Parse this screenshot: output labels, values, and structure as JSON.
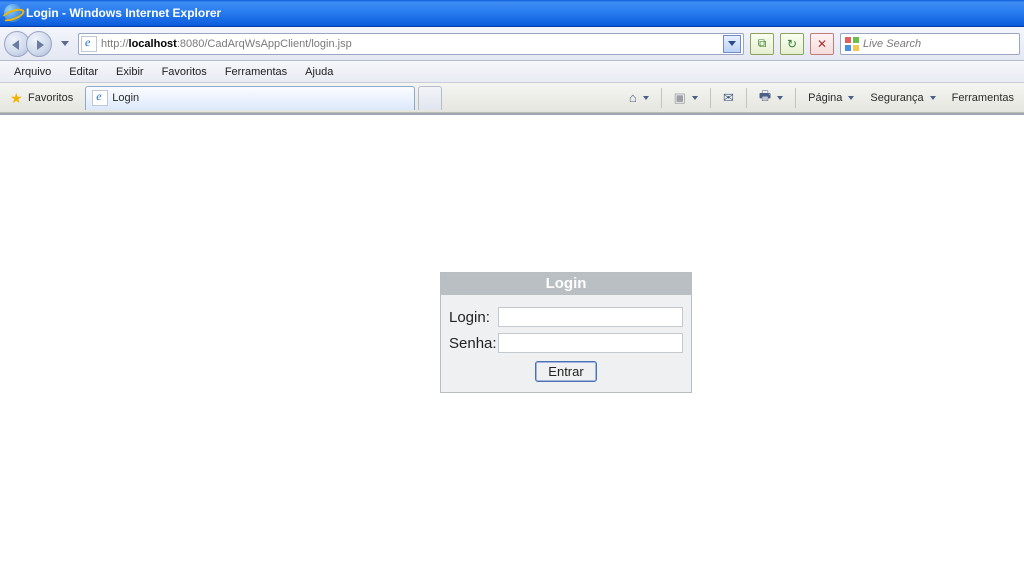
{
  "window": {
    "title": "Login - Windows Internet Explorer"
  },
  "address": {
    "prefix": "http://",
    "host": "localhost",
    "rest": ":8080/CadArqWsAppClient/login.jsp"
  },
  "search": {
    "placeholder": "Live Search"
  },
  "menu": {
    "file": "Arquivo",
    "edit": "Editar",
    "view": "Exibir",
    "favorites": "Favoritos",
    "tools": "Ferramentas",
    "help": "Ajuda"
  },
  "favbar": {
    "favorites_label": "Favoritos",
    "tab_title": "Login"
  },
  "commands": {
    "page": "Página",
    "safety": "Segurança",
    "tools": "Ferramentas"
  },
  "login_form": {
    "title": "Login",
    "login_label": "Login:",
    "password_label": "Senha:",
    "login_value": "",
    "password_value": "",
    "submit": "Entrar"
  }
}
